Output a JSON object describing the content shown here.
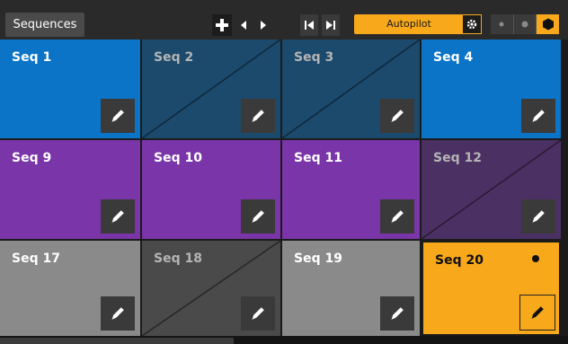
{
  "toolbar": {
    "sequences_label": "Sequences",
    "add_icon": "plus-icon",
    "prev_icon": "triangle-left-icon",
    "next_icon": "triangle-right-icon",
    "skip_back_icon": "skip-back-icon",
    "skip_forward_icon": "skip-forward-icon",
    "autopilot_label": "Autopilot",
    "autopilot_gear_icon": "gear-icon",
    "modes": [
      "mode-small-dot",
      "mode-medium-dot",
      "mode-hexagon"
    ],
    "active_mode": "mode-hexagon",
    "accent": "#f7a81b"
  },
  "grid": {
    "tiles": [
      {
        "label": "Seq 1",
        "state": "filled",
        "color": "#0b74c7"
      },
      {
        "label": "Seq 2",
        "state": "empty",
        "color": "#1c4a6c"
      },
      {
        "label": "Seq 3",
        "state": "empty",
        "color": "#1c4a6c"
      },
      {
        "label": "Seq 4",
        "state": "filled",
        "color": "#0b74c7"
      },
      {
        "label": "Seq 9",
        "state": "filled",
        "color": "#7a35a8"
      },
      {
        "label": "Seq 10",
        "state": "filled",
        "color": "#7a35a8"
      },
      {
        "label": "Seq 11",
        "state": "filled",
        "color": "#7a35a8"
      },
      {
        "label": "Seq 12",
        "state": "empty",
        "color": "#4b3163"
      },
      {
        "label": "Seq 17",
        "state": "filled",
        "color": "#8a8a8a"
      },
      {
        "label": "Seq 18",
        "state": "empty",
        "color": "#4a4a4a"
      },
      {
        "label": "Seq 19",
        "state": "filled",
        "color": "#8a8a8a"
      },
      {
        "label": "Seq 20",
        "state": "active",
        "color": "#f7a81b"
      }
    ],
    "edit_icon": "pencil-icon",
    "playing_indicator": "dot-icon"
  }
}
